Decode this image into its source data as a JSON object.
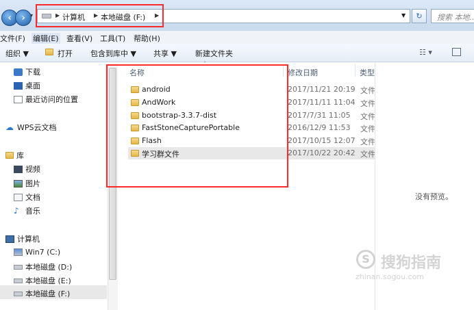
{
  "address": {
    "crumbs": [
      "计算机",
      "本地磁盘 (F:)"
    ],
    "search_placeholder": "搜索 本地..."
  },
  "menubar": [
    "文件(F)",
    "编辑(E)",
    "查看(V)",
    "工具(T)",
    "帮助(H)"
  ],
  "toolbar": {
    "organize": "组织 ▼",
    "open": "打开",
    "include_library": "包含到库中 ▼",
    "share": "共享 ▼",
    "new_folder": "新建文件夹"
  },
  "nav": {
    "favorites": [
      "下载",
      "桌面",
      "最近访问的位置"
    ],
    "wps": "WPS云文档",
    "library": "库",
    "library_items": [
      "视频",
      "图片",
      "文档",
      "音乐"
    ],
    "computer": "计算机",
    "drives": [
      "Win7 (C:)",
      "本地磁盘 (D:)",
      "本地磁盘 (E:)",
      "本地磁盘 (F:)"
    ]
  },
  "columns": {
    "name": "名称",
    "modified": "修改日期",
    "type": "类型"
  },
  "files": [
    {
      "name": "android",
      "date": "2017/11/21 20:19",
      "type": "文件"
    },
    {
      "name": "AndWork",
      "date": "2017/11/11 11:04",
      "type": "文件"
    },
    {
      "name": "bootstrap-3.3.7-dist",
      "date": "2017/7/31 11:05",
      "type": "文件"
    },
    {
      "name": "FastStoneCapturePortable",
      "date": "2016/12/9 11:53",
      "type": "文件"
    },
    {
      "name": "Flash",
      "date": "2017/10/15 12:07",
      "type": "文件"
    },
    {
      "name": "学习群文件",
      "date": "2017/10/22 20:42",
      "type": "文件"
    }
  ],
  "preview": {
    "empty_text": "没有预览。"
  },
  "watermark": {
    "brand": "搜狗指南",
    "url": "zhinan.sogou.com"
  },
  "colors": {
    "highlight": "#ff2a2a",
    "selected_row": "#e5e5e5",
    "folder": "#e5b84a"
  }
}
